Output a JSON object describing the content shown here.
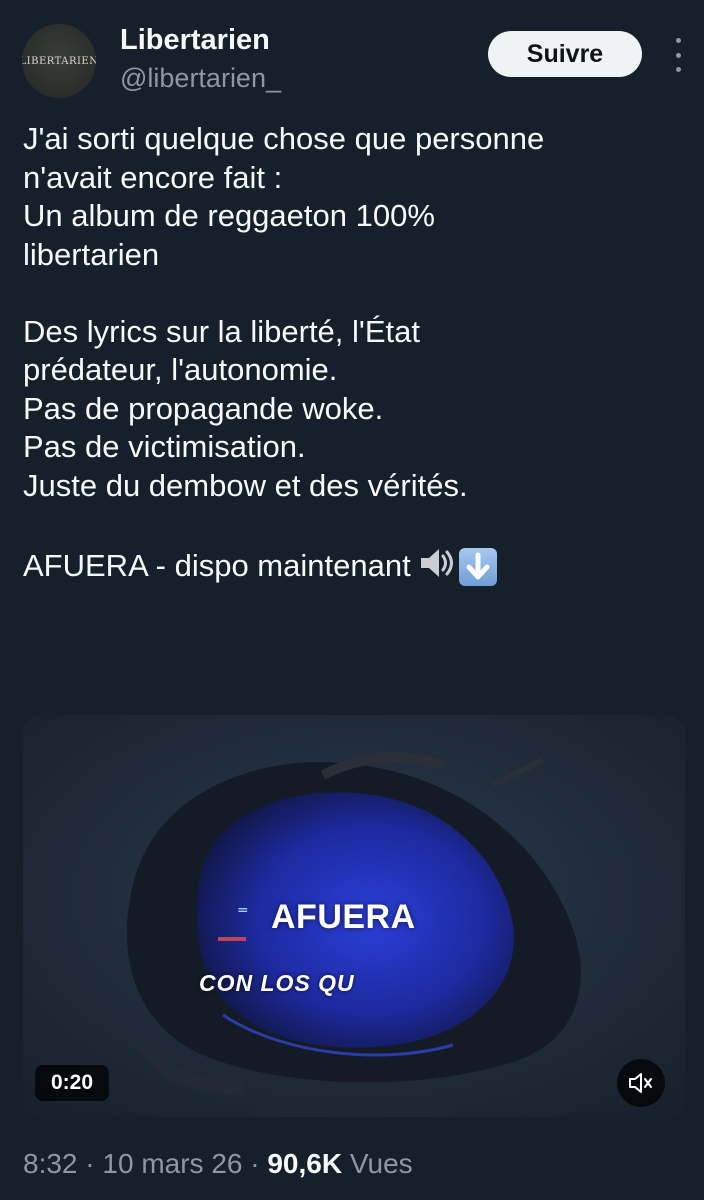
{
  "author": {
    "avatar_text": "LIBERTARIEN",
    "display_name": "Libertarien",
    "handle": "@libertarien_"
  },
  "actions": {
    "follow_label": "Suivre",
    "more_icon": "more-vertical-icon"
  },
  "tweet": {
    "lines": [
      "J'ai sorti quelque chose que personne",
      "n'avait encore fait :",
      "Un album de reggaeton 100%",
      "libertarien",
      "Des lyrics sur la liberté, l'État",
      "prédateur, l'autonomie.",
      "Pas de propagande woke.",
      "Pas de victimisation.",
      "Juste du dembow et des vérités.",
      "AFUERA - dispo maintenant"
    ],
    "emojis": [
      "speaker-loud-icon",
      "down-arrow-icon"
    ]
  },
  "media": {
    "overlay_title": "AFUERA",
    "overlay_subtitle": "CON LOS QU",
    "duration": "0:20",
    "mute_icon": "muted-speaker-icon"
  },
  "meta": {
    "time": "8:32",
    "separator": "·",
    "date": "10 mars 26",
    "views_count": "90,6K",
    "views_label": "Vues"
  },
  "colors": {
    "background": "#15202b",
    "text": "#f7f9f9",
    "secondary_text": "#8b98a5",
    "follow_button_bg": "#eff3f4"
  }
}
